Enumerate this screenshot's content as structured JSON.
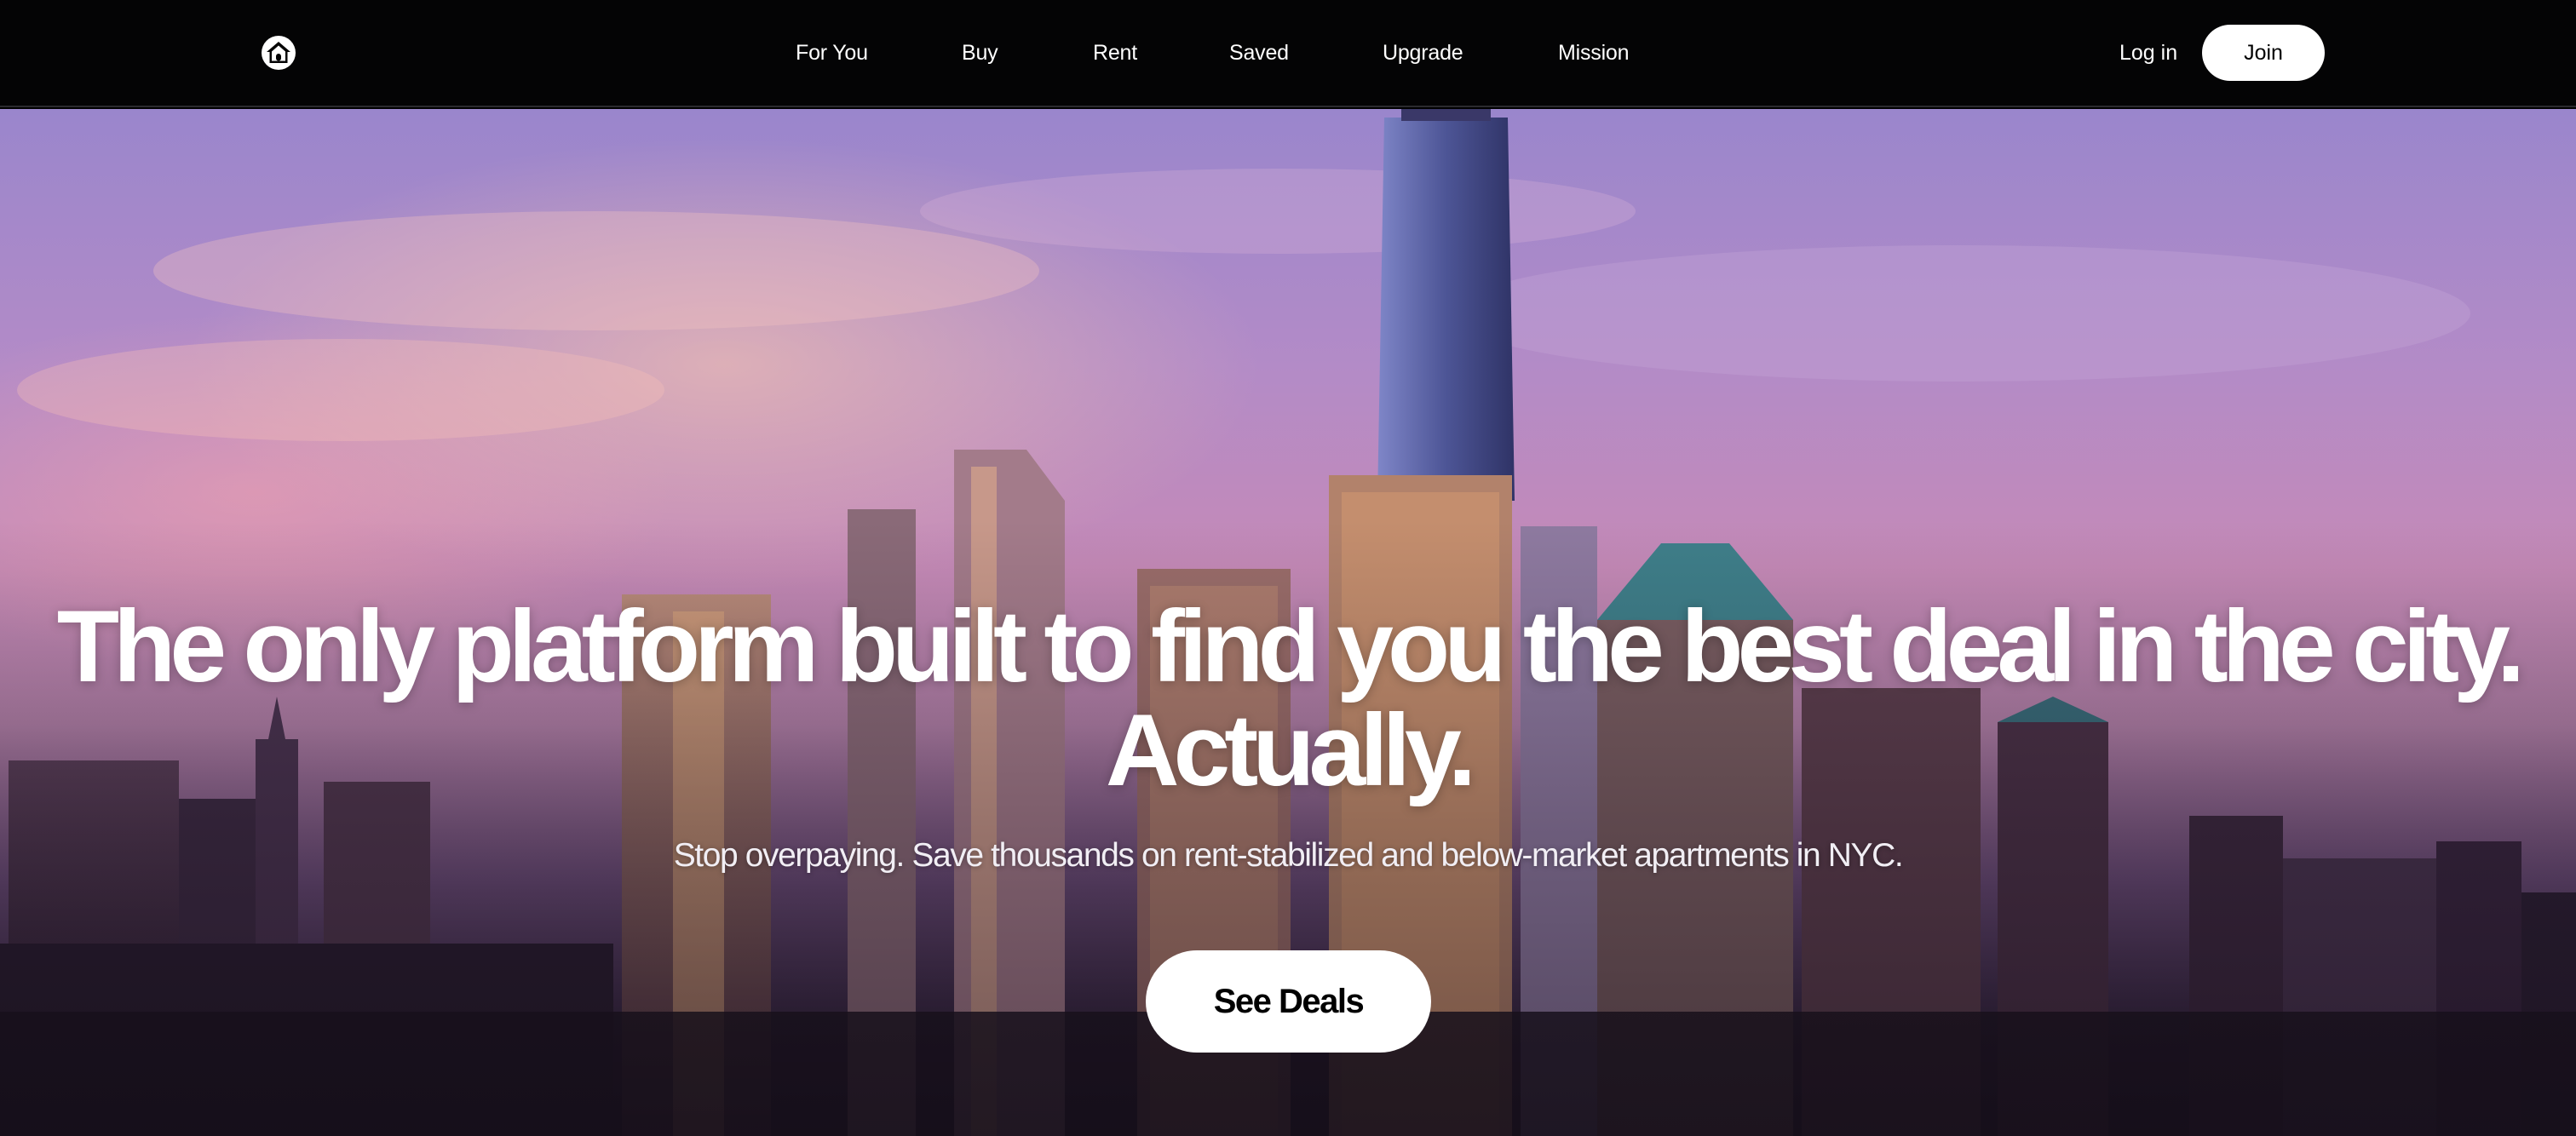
{
  "nav": {
    "logo_icon": "house-icon",
    "links": [
      {
        "label": "For You"
      },
      {
        "label": "Buy"
      },
      {
        "label": "Rent"
      },
      {
        "label": "Saved"
      },
      {
        "label": "Upgrade"
      },
      {
        "label": "Mission"
      }
    ],
    "login_label": "Log in",
    "join_label": "Join"
  },
  "hero": {
    "headline_line1": "The only platform built to find you the best deal in the city.",
    "headline_line2": "Actually.",
    "subheadline": "Stop overpaying. Save thousands on rent-stabilized and below-market apartments in NYC.",
    "cta_label": "See Deals",
    "background_image": "NYC skyline at sunset"
  },
  "colors": {
    "nav_background": "#040405",
    "button_background": "#ffffff",
    "button_text": "#000000",
    "hero_text": "#ffffff"
  }
}
